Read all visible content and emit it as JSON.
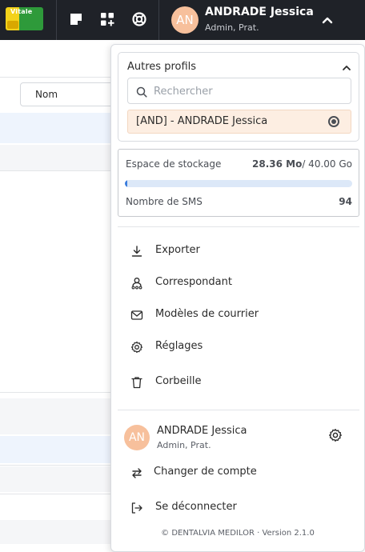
{
  "topbar": {
    "vitale_label": "Vitale",
    "icons": [
      "sticky-note-icon",
      "add-widget-icon",
      "lifebuoy-icon"
    ],
    "avatar_initials": "AN",
    "user_name": "ANDRADE Jessica",
    "user_role": "Admin, Prat."
  },
  "background": {
    "column_input": "Nom"
  },
  "dropdown": {
    "profiles": {
      "title": "Autres profils",
      "search_placeholder": "Rechercher",
      "items": [
        {
          "label": "[AND] - ANDRADE Jessica",
          "selected": true
        }
      ]
    },
    "storage": {
      "label": "Espace de stockage",
      "used": "28.36 Mo",
      "total": "/ 40.00 Go",
      "used_fraction": 0.01,
      "sms_label": "Nombre de SMS",
      "sms_count": "94"
    },
    "menu": [
      {
        "label": "Exporter",
        "icon": "download-icon"
      },
      {
        "label": "Correspondant",
        "icon": "user-network-icon"
      },
      {
        "label": "Modèles de courrier",
        "icon": "mail-icon"
      },
      {
        "label": "Réglages",
        "icon": "gear-icon"
      },
      {
        "label": "Corbeille",
        "icon": "trash-icon"
      }
    ],
    "account": {
      "initials": "AN",
      "name": "ANDRADE Jessica",
      "role": "Admin, Prat.",
      "switch_label": "Changer de compte",
      "logout_label": "Se déconnecter"
    },
    "footer": "© DENTALVIA MEDILOR · Version 2.1.0"
  },
  "colors": {
    "topbar_bg": "#1f2228",
    "accent": "#3b7ddd",
    "avatar": "#f7c09c",
    "selected_profile_bg": "#fdeee2"
  }
}
